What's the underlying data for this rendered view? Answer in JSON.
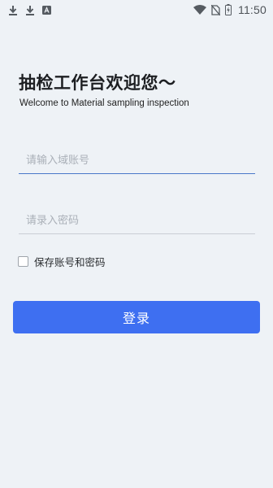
{
  "status_bar": {
    "time": "11:50",
    "left_icons": [
      "download-icon",
      "download-icon",
      "app-notification-icon"
    ],
    "right_icons": [
      "wifi-icon",
      "no-sim-icon",
      "battery-icon"
    ]
  },
  "header": {
    "title": "抽检工作台欢迎您～",
    "subtitle": "Welcome to Material sampling inspection"
  },
  "form": {
    "account_placeholder": "请输入域账号",
    "password_placeholder": "请录入密码",
    "remember_label": "保存账号和密码",
    "remember_checked": false,
    "login_label": "登录"
  },
  "colors": {
    "background": "#eef2f6",
    "accent": "#3e6ff1",
    "active_underline": "#4a78c9"
  }
}
